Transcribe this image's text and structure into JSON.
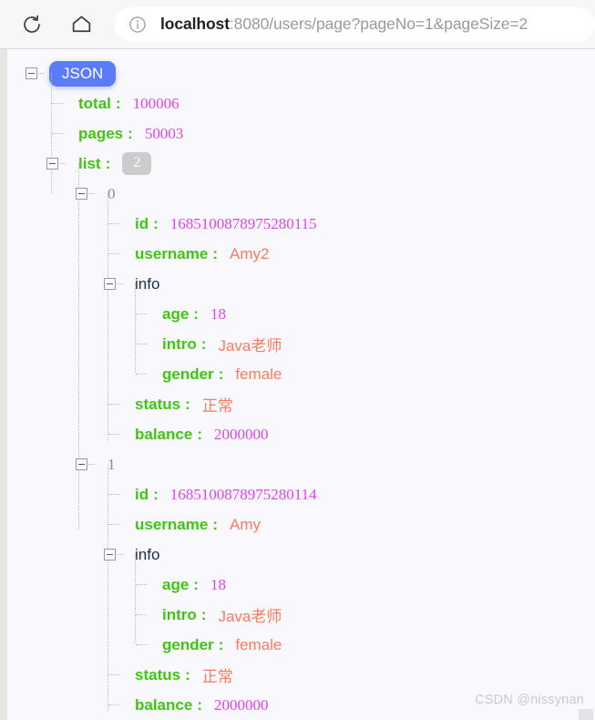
{
  "browser": {
    "reload_label": "Reload",
    "home_label": "Home",
    "site_info_label": "Site information",
    "url_host": "localhost",
    "url_rest": ":8080/users/page?pageNo=1&pageSize=2",
    "url_full": "localhost:8080/users/page?pageNo=1&pageSize=2",
    "icons": {
      "reload": "reload-icon",
      "home": "home-icon",
      "info": "info-circle-icon"
    }
  },
  "viewer": {
    "root_label": "JSON",
    "colon": ":",
    "colors": {
      "key": "#3fc611",
      "number": "#e143f0",
      "string": "#fc7b5e",
      "root_pill": "#5b7cfa",
      "count_badge": "#cccccc",
      "node_name": "#1d2b4f",
      "index_name": "#8c8c8c",
      "background": "#f8f8fd"
    }
  },
  "json": {
    "total": {
      "key": "total",
      "value": "100006"
    },
    "pages": {
      "key": "pages",
      "value": "50003"
    },
    "list": {
      "key": "list",
      "count": "2"
    },
    "items": [
      {
        "index": "0",
        "id": {
          "key": "id",
          "value": "1685100878975280115"
        },
        "username": {
          "key": "username",
          "value": "Amy2"
        },
        "info": {
          "key": "info",
          "age": {
            "key": "age",
            "value": "18"
          },
          "intro": {
            "key": "intro",
            "value": "Java老师"
          },
          "gender": {
            "key": "gender",
            "value": "female"
          }
        },
        "status": {
          "key": "status",
          "value": "正常"
        },
        "balance": {
          "key": "balance",
          "value": "2000000"
        }
      },
      {
        "index": "1",
        "id": {
          "key": "id",
          "value": "1685100878975280114"
        },
        "username": {
          "key": "username",
          "value": "Amy"
        },
        "info": {
          "key": "info",
          "age": {
            "key": "age",
            "value": "18"
          },
          "intro": {
            "key": "intro",
            "value": "Java老师"
          },
          "gender": {
            "key": "gender",
            "value": "female"
          }
        },
        "status": {
          "key": "status",
          "value": "正常"
        },
        "balance": {
          "key": "balance",
          "value": "2000000"
        }
      }
    ]
  },
  "watermark": {
    "text": "CSDN @nissynan"
  }
}
